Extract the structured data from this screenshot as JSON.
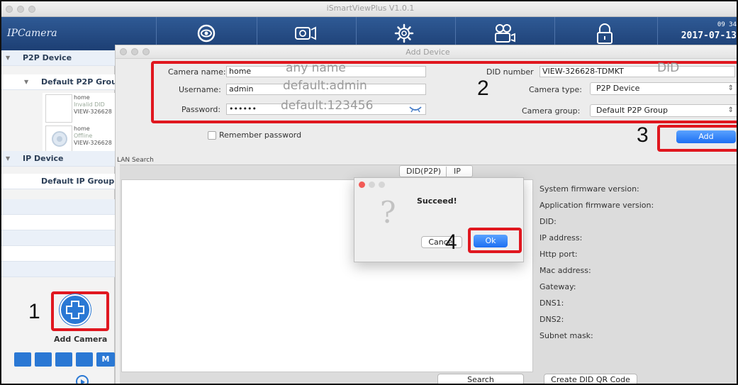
{
  "app": {
    "title": "iSmartViewPlus  V1.0.1",
    "logo": "IPCamera"
  },
  "topnav": {
    "icons": [
      "eye-icon",
      "video-camera-icon",
      "gear-icon",
      "recorder-icon",
      "lock-icon"
    ],
    "time": "09 34",
    "date": "2017-07-13"
  },
  "sidebar": {
    "p2p_title": "P2P Device",
    "p2p_group": "Default P2P Group",
    "cameras": [
      {
        "name": "home",
        "status": "Invalid DID",
        "did": "VIEW-326628"
      },
      {
        "name": "home",
        "status": "Offline",
        "did": "VIEW-326628"
      }
    ],
    "ip_title": "IP Device",
    "ip_group": "Default IP Group",
    "add_camera_label": "Add Camera",
    "grid_last_label": "M"
  },
  "add_device": {
    "title": "Add Device",
    "camera_name_label": "Camera name:",
    "camera_name_value": "home",
    "camera_name_hint": "any name",
    "username_label": "Username:",
    "username_value": "admin",
    "username_hint": "default:admin",
    "password_label": "Password:",
    "password_value": "••••••",
    "password_hint": "default:123456",
    "did_label": "DID number",
    "did_value": "VIEW-326628-TDMKT",
    "did_hint": "DID",
    "camera_type_label": "Camera type:",
    "camera_type_value": "P2P Device",
    "camera_group_label": "Camera group:",
    "camera_group_value": "Default P2P Group",
    "remember_label": "Remember password",
    "add_button": "Add"
  },
  "lan_search": {
    "label": "LAN Search",
    "tabs": [
      "DID(P2P)",
      "IP"
    ],
    "info_fields": [
      "System firmware version:",
      "Application firmware version:",
      "DID:",
      "IP address:",
      "Http port:",
      "Mac address:",
      "Gateway:",
      "DNS1:",
      "DNS2:",
      "Subnet mask:"
    ],
    "search_button": "Search",
    "qr_button": "Create DID QR Code"
  },
  "alert": {
    "message": "Succeed!",
    "cancel": "Cancel",
    "ok": "Ok"
  },
  "steps": [
    "1",
    "2",
    "3",
    "4"
  ],
  "colors": {
    "annotation_red": "#e0171f",
    "nav_blue": "#2a4f87",
    "button_blue": "#1d6ff2"
  }
}
